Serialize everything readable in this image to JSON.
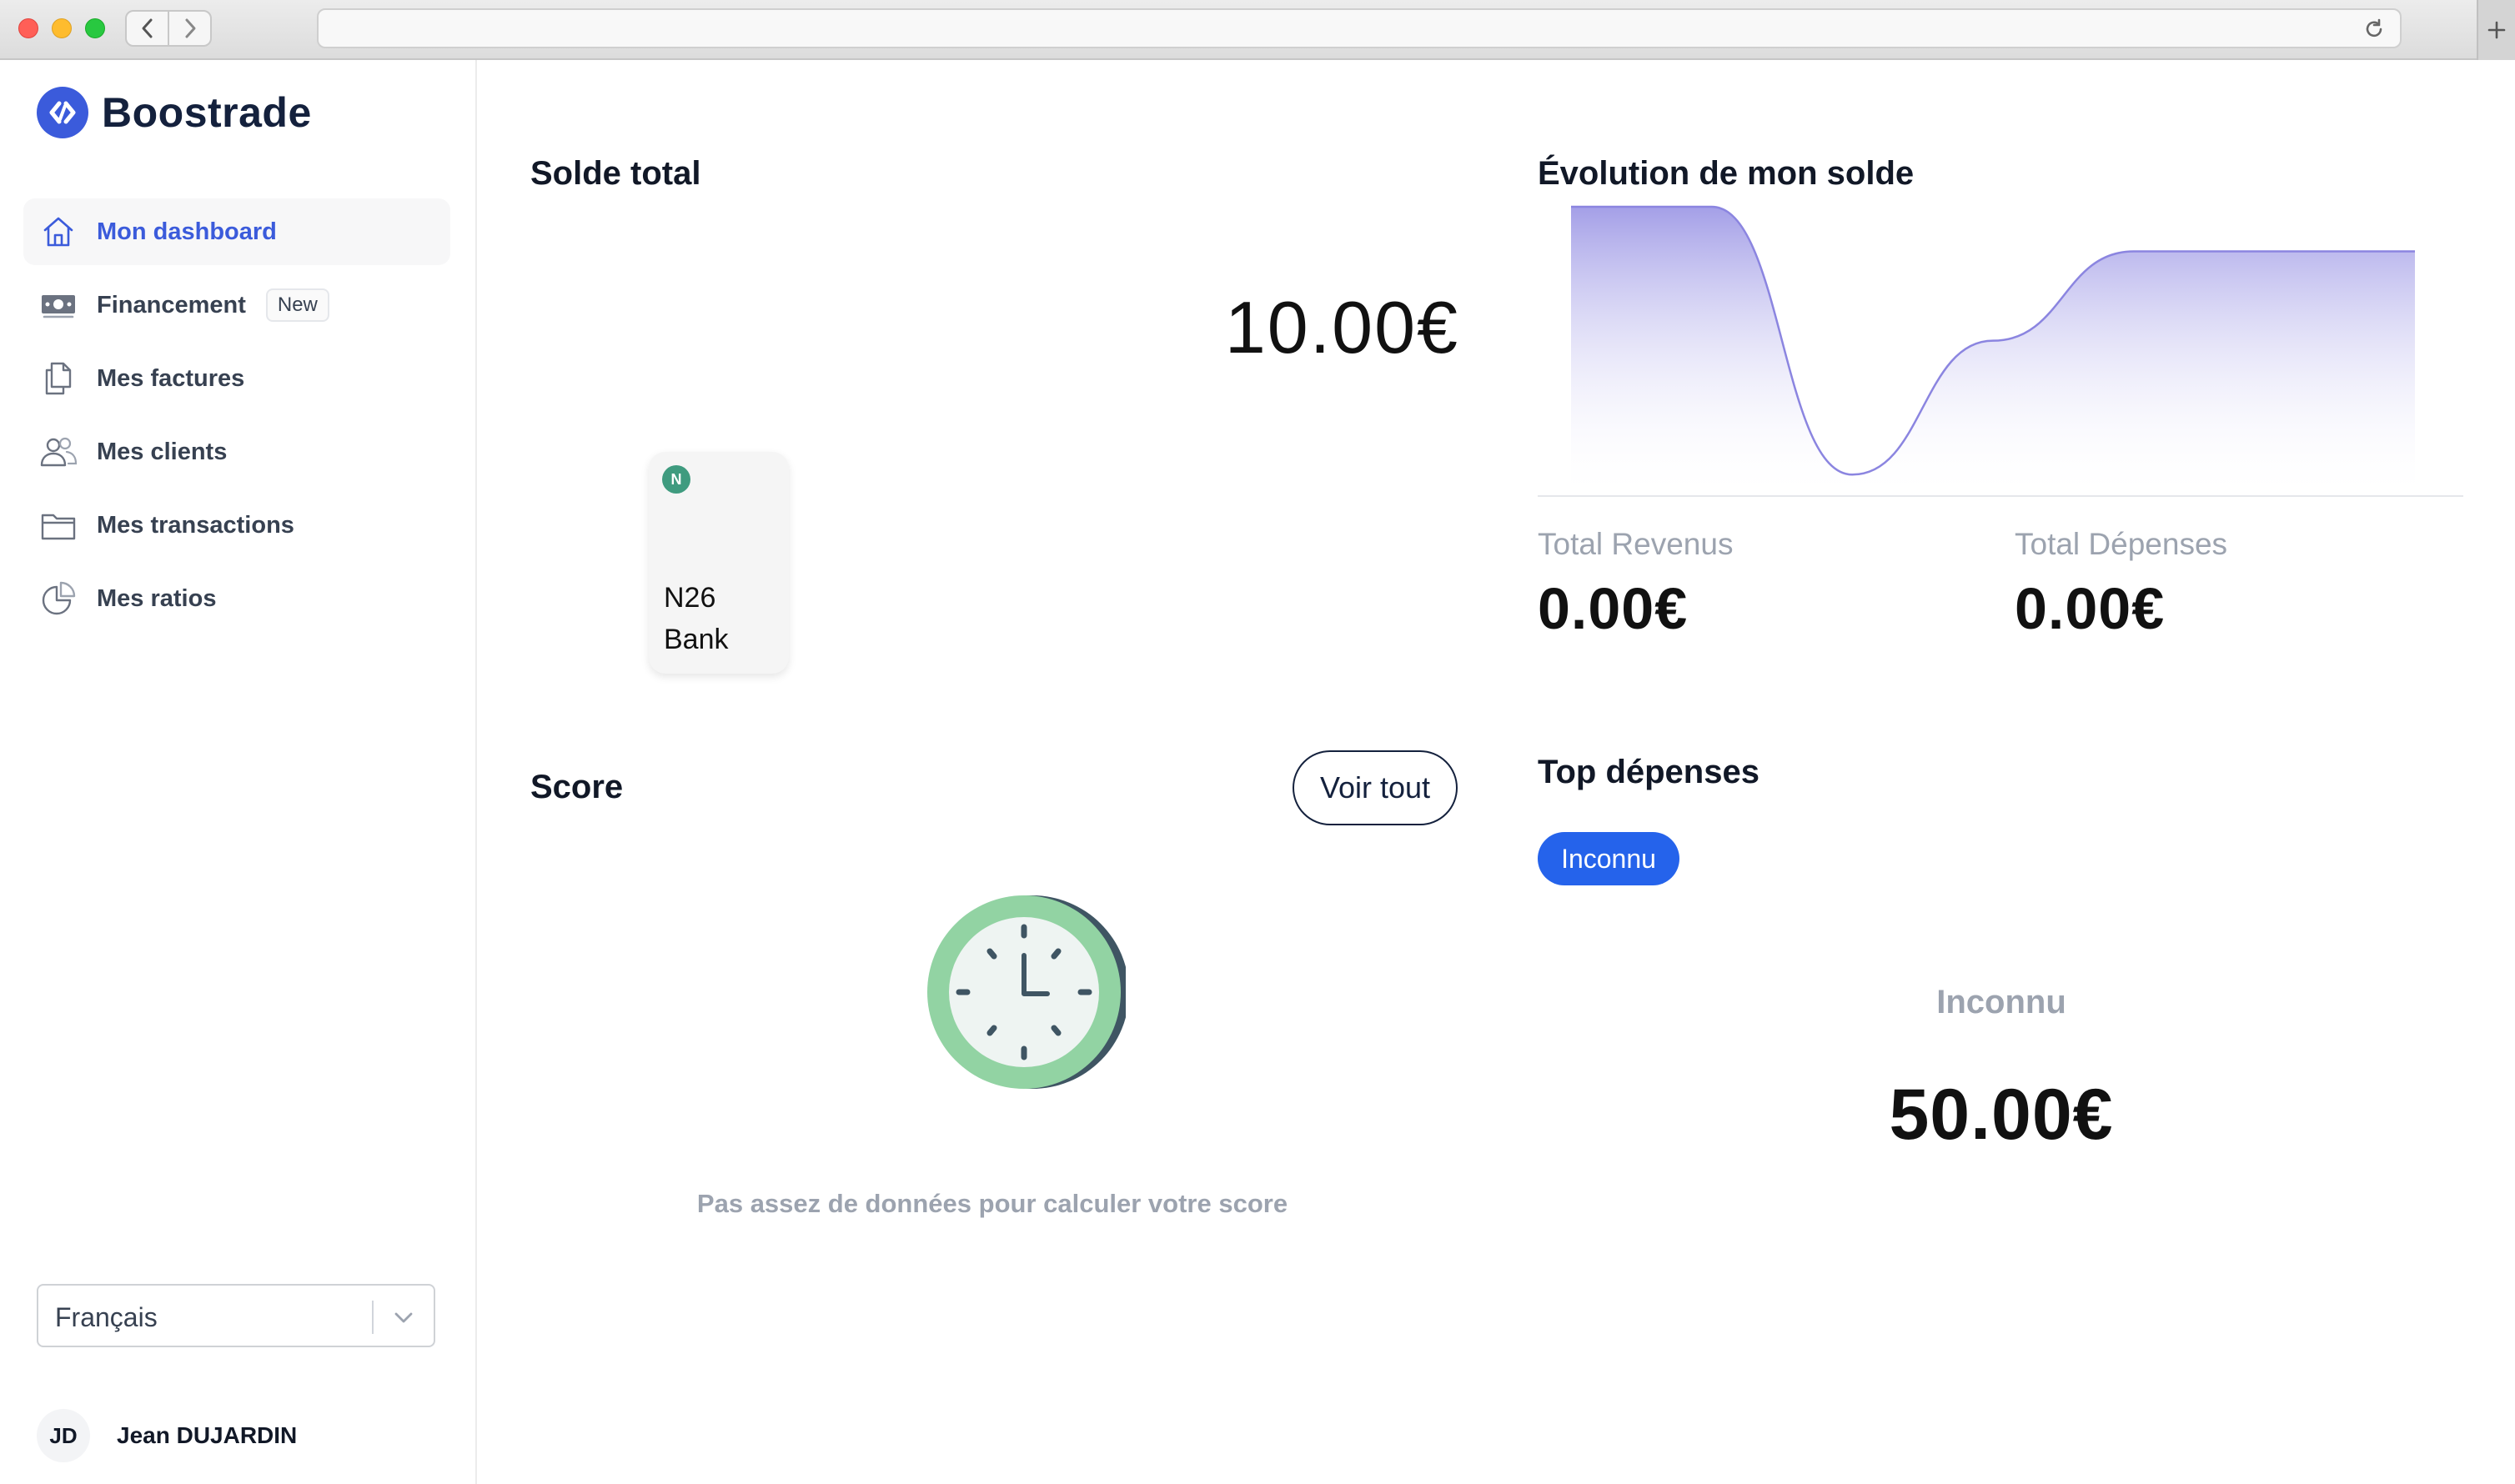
{
  "brand": {
    "name": "Boostrade",
    "accent": "#3b5bdb",
    "dark": "#14213d"
  },
  "sidebar": {
    "items": [
      {
        "label": "Mon dashboard",
        "icon": "home-icon",
        "active": true
      },
      {
        "label": "Financement",
        "icon": "banknote-icon",
        "badge": "New"
      },
      {
        "label": "Mes factures",
        "icon": "documents-icon"
      },
      {
        "label": "Mes clients",
        "icon": "users-icon"
      },
      {
        "label": "Mes transactions",
        "icon": "folder-icon"
      },
      {
        "label": "Mes ratios",
        "icon": "pie-chart-icon"
      }
    ],
    "language": "Français",
    "user": {
      "initials": "JD",
      "name": "Jean DUJARDIN"
    }
  },
  "main": {
    "solde": {
      "title": "Solde total",
      "amount": "10.00€",
      "bank": {
        "logo": "N",
        "name": "N26 Bank"
      }
    },
    "score": {
      "title": "Score",
      "button": "Voir tout",
      "message": "Pas assez de données pour calculer votre score",
      "icon": "clock-icon"
    },
    "evolution": {
      "title": "Évolution de mon solde",
      "revenus_label": "Total Revenus",
      "revenus_value": "0.00€",
      "depenses_label": "Total Dépenses",
      "depenses_value": "0.00€"
    },
    "top": {
      "title": "Top dépenses",
      "chip": "Inconnu",
      "category": "Inconnu",
      "amount": "50.00€"
    }
  },
  "chart_data": {
    "type": "area",
    "x": [
      0,
      1,
      2,
      3,
      4,
      5,
      6
    ],
    "values": [
      10,
      10,
      -50,
      -20,
      0,
      0,
      0
    ],
    "ylim": [
      -52,
      10
    ],
    "grid": false,
    "color": "#8b85e0"
  }
}
